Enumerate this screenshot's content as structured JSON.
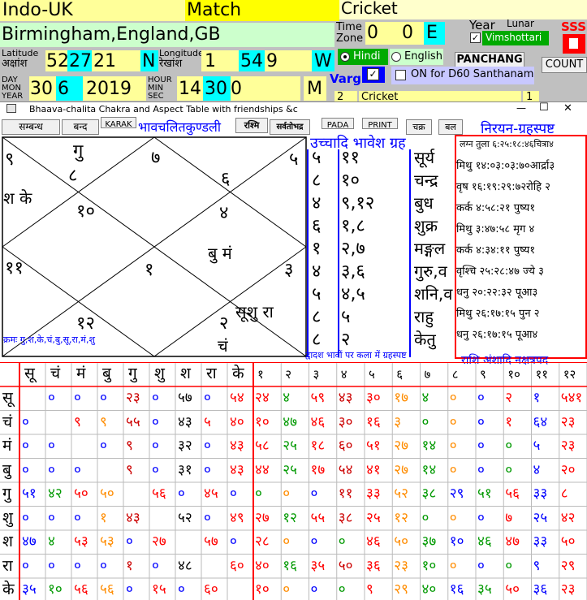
{
  "top": {
    "location_tag": "Indo-UK",
    "match_label": "Match",
    "cricket_label": "Cricket",
    "place": "Birmingham,England,GB",
    "timezone_label": "Time Zone",
    "tz_h": "0",
    "tz_m": "0",
    "tz_dir": "E",
    "year_label": "Year",
    "lunar_label": "Lunar",
    "vimshottari_label": "Vimshottari",
    "sss_label": "SSS",
    "latitude_label": "Latitude",
    "lat_deva": "अक्षांश",
    "lat_d": "52",
    "lat_m": "27",
    "lat_s": "21",
    "lat_dir": "N",
    "longitude_label": "Longitude",
    "lon_deva": "रेखांश",
    "lon_d": "1",
    "lon_m": "54",
    "lon_s": "9",
    "lon_dir": "W",
    "hindi_label": "Hindi",
    "english_label": "English",
    "panchang_label": "PANCHANG",
    "count_label": "COUNT",
    "date_label": "DAY MON YEAR",
    "day": "30",
    "mon": "6",
    "year": "2019",
    "time_label": "HOUR MIN SEC",
    "hour": "14",
    "min": "30",
    "sec": "0",
    "ampm": "M",
    "varg_label": "Varg",
    "d60_label": "ON for D60 Santhanam",
    "row2_num": "2",
    "row2_text": "Cricket",
    "row2_right": "1"
  },
  "window": {
    "title": "Bhaava-chalita Chakra and Aspect Table with friendships &c",
    "minimize": "—",
    "maximize": "☐",
    "close": "✕"
  },
  "toolbar": {
    "b1": "सम्बन्ध",
    "b2": "बन्द",
    "karak": "KARAK",
    "title_deva": "भावचलितकुण्डली",
    "b3": "रश्मि",
    "b4": "सर्वतोभद्र",
    "pada": "PADA",
    "print": "PRINT",
    "b5": "चक्र",
    "b6": "बल",
    "nirayan": "निरयन-ग्रहस्पष्ट"
  },
  "chart": {
    "h1": "गु",
    "h1n": "८",
    "h2": "७",
    "h2n": "६",
    "h3": "९",
    "h4": "५",
    "h5": "श के",
    "h6": "१०",
    "h7": "४",
    "h8": "बु मं",
    "h9": "११",
    "h10": "१",
    "h11": "३",
    "h12": "१२",
    "h13": "२",
    "h14": "सूशु रा",
    "h15": "चं"
  },
  "middle": {
    "header": "उच्चादि भावेश ग्रह",
    "rows": [
      {
        "a": "५",
        "b": "११",
        "c": "सूर्य"
      },
      {
        "a": "८",
        "b": "१०",
        "c": "चन्द्र"
      },
      {
        "a": "४",
        "b": "९,१२",
        "c": "बुध"
      },
      {
        "a": "६",
        "b": "१,८",
        "c": "शुक्र"
      },
      {
        "a": "१",
        "b": "२,७",
        "c": "मङ्गल"
      },
      {
        "a": "४",
        "b": "३,६",
        "c": "गुरु,व"
      },
      {
        "a": "५",
        "b": "४,५",
        "c": "शनि,व"
      },
      {
        "a": "८",
        "b": "५",
        "c": "राहु"
      },
      {
        "a": "८",
        "b": "२",
        "c": "केतु"
      }
    ]
  },
  "right": {
    "rows": [
      "लग्न तुला ६:२५:१८:४६चित्रा४",
      "मिथु १४:०३:०३:७०आर्द्रा३",
      "वृष १६:१९:२९:७२रोहि २",
      "कर्क ४:५८:२१ पुष्य१",
      "मिथु ३:४७:५८ मृग ४",
      "कर्क ४:३४:११ पुष्य१",
      "वृश्चि २५:२८:४७ ज्ये ३",
      "धनु २०:२२:३२ पूआ३",
      "मिथु २६:१७:१५ पुन २",
      "धनु २६:१७:१५ पूआ४"
    ]
  },
  "krama": "क्रमः गु,श,के,चं,बु,सू,रा,मं,शु",
  "aspect_title": "द्वादश भावों पर कला में ग्रहस्पष्ट",
  "rashi_title": "राशि अंशादि नक्षत्रपद",
  "table": {
    "col_heads": [
      "सू",
      "चं",
      "मं",
      "बु",
      "गु",
      "शु",
      "श",
      "रा",
      "के"
    ],
    "house_heads": [
      "१",
      "२",
      "३",
      "४",
      "५",
      "६",
      "७",
      "८",
      "९",
      "१०",
      "११",
      "१२"
    ],
    "row_heads": [
      "सू",
      "चं",
      "मं",
      "बु",
      "गु",
      "शु",
      "श",
      "रा",
      "के"
    ],
    "rows": [
      [
        "",
        "०",
        "०",
        "०",
        "२३",
        "०",
        "५७",
        "०",
        "५४",
        "२४",
        "४",
        "५९",
        "४३",
        "३०",
        "१७",
        "४",
        "०",
        "०",
        "२",
        "१",
        "५४१"
      ],
      [
        "०",
        "",
        "९",
        "९",
        "५५",
        "०",
        "४३",
        "५",
        "४०",
        "१०",
        "४७",
        "४६",
        "३०",
        "१६",
        "३",
        "०",
        "०",
        "०",
        "१",
        "६४",
        "२३"
      ],
      [
        "०",
        "०",
        "",
        "०",
        "९",
        "०",
        "३२",
        "०",
        "४३",
        "५८",
        "२५",
        "१८",
        "६०",
        "५१",
        "२७",
        "१४",
        "०",
        "०",
        "०",
        "५",
        "२३"
      ],
      [
        "०",
        "०",
        "०",
        "",
        "९",
        "०",
        "३१",
        "०",
        "४३",
        "४४",
        "२५",
        "१७",
        "५४",
        "४१",
        "२७",
        "१४",
        "०",
        "०",
        "०",
        "४",
        "२०"
      ],
      [
        "५१",
        "४२",
        "५०",
        "५०",
        "",
        "५६",
        "०",
        "४५",
        "०",
        "०",
        "०",
        "०",
        "११",
        "३३",
        "५२",
        "३८",
        "२९",
        "५१",
        "५६",
        "३३",
        "८"
      ],
      [
        "०",
        "०",
        "०",
        "१",
        "४३",
        "",
        "५२",
        "०",
        "४९",
        "२७",
        "१२",
        "५५",
        "३८",
        "२५",
        "१२",
        "०",
        "०",
        "०",
        "७",
        "२५",
        "४२"
      ],
      [
        "४७",
        "४",
        "५३",
        "५३",
        "०",
        "२७",
        "",
        "५७",
        "०",
        "२८",
        "०",
        "०",
        "०",
        "४६",
        "५०",
        "३७",
        "१०",
        "४६",
        "४७",
        "३३",
        "५०"
      ],
      [
        "०",
        "०",
        "०",
        "०",
        "१",
        "०",
        "४८",
        "",
        "६०",
        "४०",
        "१६",
        "३५",
        "५०",
        "३६",
        "२३",
        "१०",
        "०",
        "०",
        "०",
        "९",
        "२९"
      ],
      [
        "३५",
        "१०",
        "५६",
        "५६",
        "०",
        "१५",
        "०",
        "६०",
        "",
        "१०",
        "०",
        "०",
        "०",
        "९",
        "२९",
        "४०",
        "१६",
        "३५",
        "५०",
        "३६",
        "२३"
      ]
    ]
  },
  "colors": {
    "red": "#ff0000",
    "blue": "#0000ff",
    "green": "#009900",
    "orange": "#ff8c00",
    "yellow": "#ffff99"
  }
}
